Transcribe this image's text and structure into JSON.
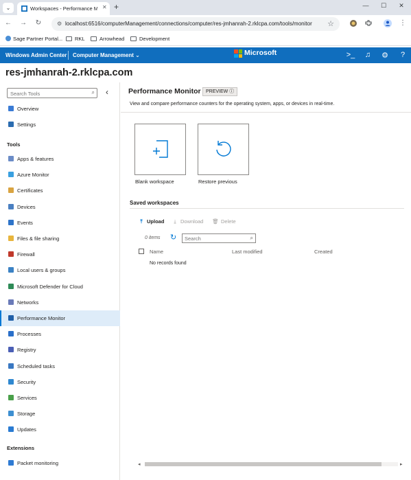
{
  "browser": {
    "tab_title": "Workspaces - Performance Monitor",
    "tab_menu_glyph": "⌄",
    "new_tab_glyph": "+",
    "close_glyph": "✕",
    "minimize_glyph": "—",
    "maximize_glyph": "☐",
    "url": "localhost:6516/computerManagement/connections/computer/res-jmhanrah-2.rklcpa.com/tools/monitor",
    "bookmarks": [
      "Sage Partner Portal...",
      "RKL",
      "Arrowhead",
      "Development"
    ]
  },
  "wac": {
    "app_title": "Windows Admin Center",
    "context": "Computer Management",
    "context_chevron": "⌄",
    "brand": "Microsoft",
    "header_icons": [
      "terminal-icon",
      "bell-icon",
      "gear-icon",
      "help-icon"
    ],
    "colors": {
      "header": "#106ebe",
      "accent": "#0078d4",
      "selected": "#deecf9"
    }
  },
  "server": {
    "name": "res-jmhanrah-2.rklcpa.com"
  },
  "sidebar": {
    "search_placeholder": "Search Tools",
    "top_items": [
      {
        "label": "Overview",
        "icon": "overview-icon",
        "color": "#3a7bd5"
      },
      {
        "label": "Settings",
        "icon": "settings-icon",
        "color": "#2b6cb0"
      }
    ],
    "tools_heading": "Tools",
    "tools": [
      {
        "label": "Apps & features",
        "icon": "apps-icon",
        "color": "#6b8cc7"
      },
      {
        "label": "Azure Monitor",
        "icon": "azure-monitor-icon",
        "color": "#3aa0e0"
      },
      {
        "label": "Certificates",
        "icon": "certificate-icon",
        "color": "#d9a441"
      },
      {
        "label": "Devices",
        "icon": "devices-icon",
        "color": "#4a7fc1"
      },
      {
        "label": "Events",
        "icon": "events-icon",
        "color": "#2e74c9"
      },
      {
        "label": "Files & file sharing",
        "icon": "folder-icon",
        "color": "#e8b53d"
      },
      {
        "label": "Firewall",
        "icon": "firewall-icon",
        "color": "#c0392b"
      },
      {
        "label": "Local users & groups",
        "icon": "users-icon",
        "color": "#3b82c4"
      },
      {
        "label": "Microsoft Defender for Cloud",
        "icon": "defender-icon",
        "color": "#2e8b57"
      },
      {
        "label": "Networks",
        "icon": "network-icon",
        "color": "#6a7ab8"
      },
      {
        "label": "Performance Monitor",
        "icon": "performance-icon",
        "color": "#1f5fa8"
      },
      {
        "label": "Processes",
        "icon": "processes-icon",
        "color": "#2a6fc9"
      },
      {
        "label": "Registry",
        "icon": "registry-icon",
        "color": "#4b5fb5"
      },
      {
        "label": "Scheduled tasks",
        "icon": "tasks-icon",
        "color": "#3a78c2"
      },
      {
        "label": "Security",
        "icon": "security-icon",
        "color": "#2f88d0"
      },
      {
        "label": "Services",
        "icon": "services-icon",
        "color": "#4aa04a"
      },
      {
        "label": "Storage",
        "icon": "storage-icon",
        "color": "#3d8fd1"
      },
      {
        "label": "Updates",
        "icon": "updates-icon",
        "color": "#2a7bd2"
      }
    ],
    "active_tool": "Performance Monitor",
    "extensions_heading": "Extensions",
    "extensions": [
      {
        "label": "Packet monitoring",
        "icon": "packet-icon",
        "color": "#2f7bd3"
      }
    ]
  },
  "main": {
    "title": "Performance Monitor",
    "badge": "PREVIEW",
    "badge_info_glyph": "ⓘ",
    "description": "View and compare performance counters for the operating system, apps, or devices in real-time.",
    "tiles": [
      "Blank workspace",
      "Restore previous"
    ],
    "saved_heading": "Saved workspaces",
    "commands": {
      "upload": "Upload",
      "download": "Download",
      "delete": "Delete"
    },
    "item_count": "0 items",
    "grid_search_placeholder": "Search",
    "columns": [
      "Name",
      "Last modified",
      "Created"
    ],
    "empty_text": "No records found"
  }
}
